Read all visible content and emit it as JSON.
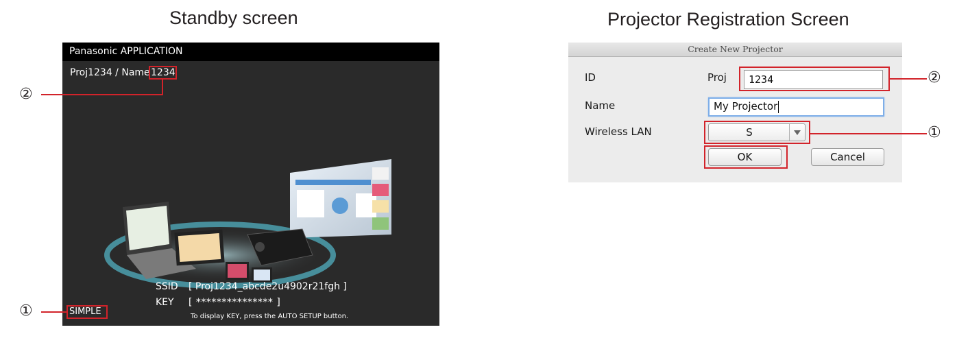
{
  "headings": {
    "standby": "Standby screen",
    "registration": "Projector Registration Screen"
  },
  "standby": {
    "topbar_title": "Panasonic APPLICATION",
    "proj_line_prefix": "Proj1234 / Name",
    "proj_line_number": "1234",
    "ssid_label": "SSID",
    "ssid_value": "[ Proj1234_abcde2u4902r21fgh ]",
    "key_label": "KEY",
    "key_value": "[ *************** ]",
    "key_hint": "To display KEY, press the AUTO SETUP button.",
    "mode_label": "SIMPLE"
  },
  "dialog": {
    "title": "Create New Projector",
    "id_label": "ID",
    "id_prefix": "Proj",
    "id_value": "1234",
    "name_label": "Name",
    "name_value": "My Projector",
    "wlan_label": "Wireless LAN",
    "wlan_value": "S",
    "ok_label": "OK",
    "cancel_label": "Cancel"
  },
  "callouts": {
    "one": "①",
    "two": "②"
  },
  "colors": {
    "highlight": "#d2232a",
    "standby_bg": "#2a2a2a",
    "dialog_bg": "#ececec"
  }
}
